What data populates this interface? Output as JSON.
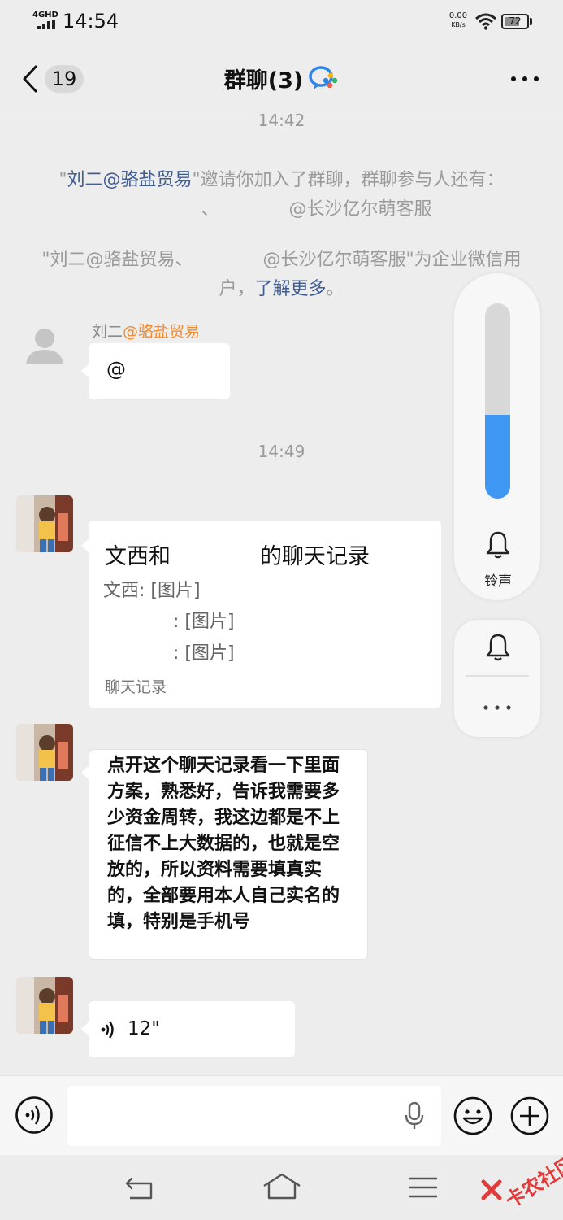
{
  "status_bar": {
    "network_type": "4GHD",
    "time": "14:54",
    "net_speed_value": "0.00",
    "net_speed_unit": "KB/s",
    "battery": "72",
    "battery_level": 0.72
  },
  "header": {
    "unread_count": "19",
    "title": "群聊(3)",
    "icons": [
      "back-icon",
      "wecom-icon",
      "more-icon"
    ]
  },
  "chat": {
    "time_1": "14:42",
    "system_1": {
      "quote_open": "\"",
      "inviter": "刘二@骆盐贸易",
      "text_a": "\"邀请你加入了群聊，群聊参与人还有：",
      "sep": "、",
      "member": "@长沙亿尔萌客服"
    },
    "system_2": {
      "text_a": "\"刘二@骆盐贸易、",
      "member": "@长沙亿尔萌客服\"为企业微信用户，",
      "link": "了解更多",
      "end": "。"
    },
    "msg_1": {
      "sender_name": "刘二",
      "sender_org": "@骆盐贸易",
      "text": "@"
    },
    "time_2": "14:49",
    "msg_2": {
      "record_title_a": "文西和",
      "record_title_b": "的聊天记录",
      "line_1": "文西: [图片]",
      "line_2": ": [图片]",
      "line_3": ": [图片]",
      "footer": "聊天记录"
    },
    "msg_3": {
      "text": "点开这个聊天记录看一下里面方案，熟悉好，告诉我需要多少资金周转，我这边都是不上征信不上大数据的，也就是空放的，所以资料需要填真实的，全部要用本人自己实名的填，特别是手机号"
    },
    "msg_4": {
      "duration": "12\""
    }
  },
  "volume_panel": {
    "level": 0.43,
    "ring_label": "铃声",
    "accent": "#3f97f4"
  },
  "input_bar": {
    "placeholder": ""
  },
  "watermark": {
    "text": "卡农社区"
  }
}
